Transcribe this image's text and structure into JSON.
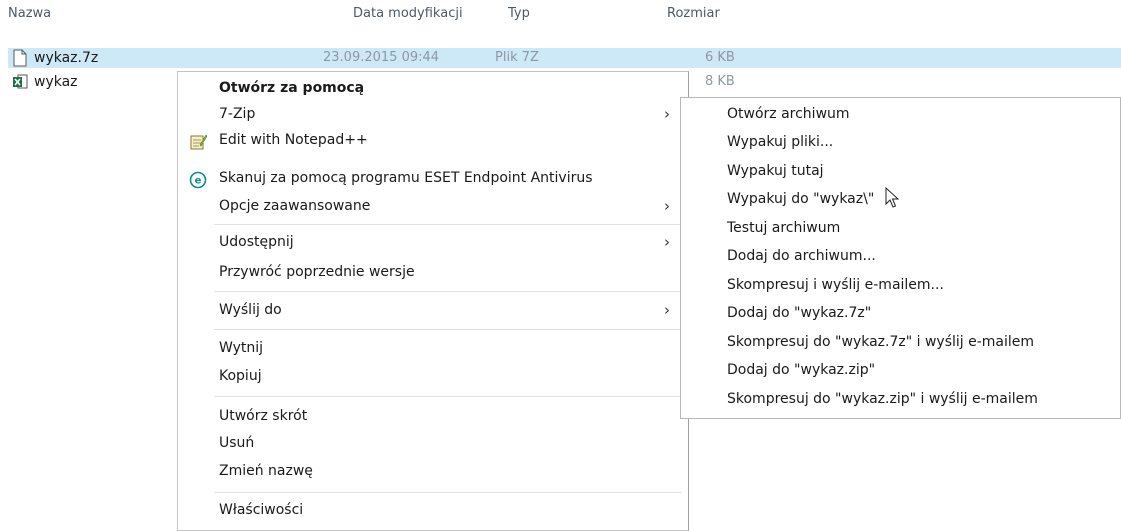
{
  "explorer": {
    "columns": {
      "name": "Nazwa",
      "date": "Data modyfikacji",
      "type": "Typ",
      "size": "Rozmiar"
    },
    "files": [
      {
        "name": "wykaz.7z",
        "date": "23.09.2015 09:44",
        "type": "Plik 7Z",
        "size": "6 KB",
        "icon": "file-icon",
        "selected": true
      },
      {
        "name": "wykaz",
        "date": "",
        "type": "",
        "size": "8 KB",
        "icon": "excel-icon",
        "selected": false
      }
    ]
  },
  "context_menu": {
    "items": [
      {
        "label": "Otwórz za pomocą",
        "bold": true
      },
      {
        "label": "7-Zip",
        "submenu": true
      },
      {
        "label": "Edit with Notepad++",
        "icon": "notepad-plus-plus-icon"
      },
      {
        "label": "Skanuj za pomocą programu ESET Endpoint Antivirus",
        "icon": "eset-icon"
      },
      {
        "label": "Opcje zaawansowane",
        "submenu": true
      },
      {
        "label": "Udostępnij",
        "submenu": true
      },
      {
        "label": "Przywróć poprzednie wersje"
      },
      {
        "label": "Wyślij do",
        "submenu": true
      },
      {
        "label": "Wytnij"
      },
      {
        "label": "Kopiuj"
      },
      {
        "label": "Utwórz skrót"
      },
      {
        "label": "Usuń"
      },
      {
        "label": "Zmień nazwę"
      },
      {
        "label": "Właściwości"
      }
    ]
  },
  "submenu_7zip": {
    "items": [
      "Otwórz archiwum",
      "Wypakuj pliki...",
      "Wypakuj tutaj",
      "Wypakuj do \"wykaz\\\"",
      "Testuj archiwum",
      "Dodaj do archiwum...",
      "Skompresuj i wyślij e-mailem...",
      "Dodaj do \"wykaz.7z\"",
      "Skompresuj do \"wykaz.7z\" i wyślij e-mailem",
      "Dodaj do \"wykaz.zip\"",
      "Skompresuj do \"wykaz.zip\" i wyślij e-mailem"
    ]
  },
  "colors": {
    "selection": "#cde8f7",
    "excel_green": "#1e7145",
    "eset_teal": "#0a8c8a"
  }
}
